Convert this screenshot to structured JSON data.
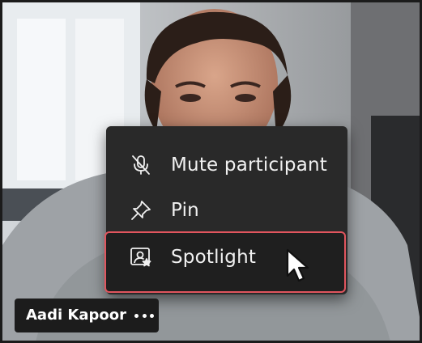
{
  "participant": {
    "name": "Aadi Kapoor"
  },
  "context_menu": {
    "items": [
      {
        "label": "Mute participant",
        "icon": "mic-off-icon"
      },
      {
        "label": "Pin",
        "icon": "pin-icon"
      },
      {
        "label": "Spotlight",
        "icon": "spotlight-icon",
        "highlighted": true
      }
    ]
  },
  "colors": {
    "menu_bg": "#292929",
    "highlight_border": "#e0555e",
    "text": "#f1f1f1"
  }
}
